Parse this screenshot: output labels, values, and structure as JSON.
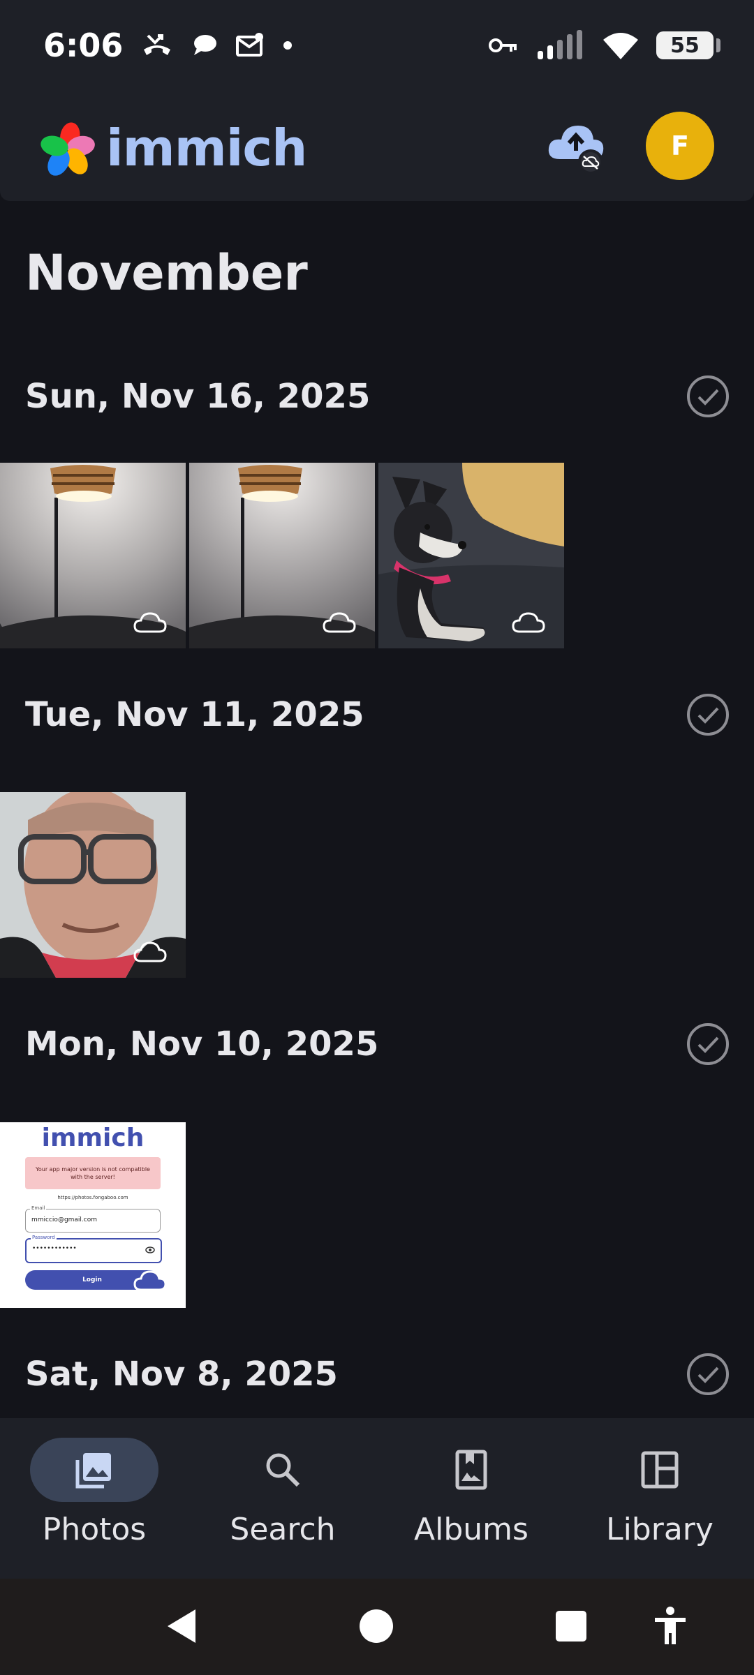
{
  "status_bar": {
    "time": "6:06",
    "battery": "55",
    "icons": [
      "missed-call-icon",
      "chat-bubble-icon",
      "mail-icon",
      "dot-icon",
      "vpn-key-icon",
      "signal-icon",
      "wifi-icon",
      "battery-icon"
    ]
  },
  "header": {
    "app_name": "immich",
    "avatar_letter": "F",
    "colors": {
      "brand_text": "#a9c3f5",
      "avatar_bg": "#e8b10c",
      "backup_icon": "#a9c3f5"
    }
  },
  "timeline": {
    "month": "November",
    "groups": [
      {
        "date": "Sun, Nov 16, 2025",
        "photos": [
          {
            "subject": "lamp",
            "icon": "cloud-icon"
          },
          {
            "subject": "lamp",
            "icon": "cloud-icon"
          },
          {
            "subject": "dog",
            "icon": "cloud-icon"
          }
        ]
      },
      {
        "date": "Tue, Nov 11, 2025",
        "photos": [
          {
            "subject": "selfie",
            "icon": "cloud-icon"
          }
        ]
      },
      {
        "date": "Mon, Nov 10, 2025",
        "photos": [
          {
            "subject": "login-screenshot",
            "icon": "cloud-icon"
          }
        ]
      },
      {
        "date": "Sat, Nov 8, 2025",
        "photos": []
      }
    ]
  },
  "screenshot_thumb": {
    "logo_text": "immich",
    "error": "Your app major version is not compatible with the server!",
    "server_url": "https://photos.fongaboo.com",
    "email_label": "Email",
    "email": "mmiccio@gmail.com",
    "password_label": "Password",
    "password_dots": "••••••••••••",
    "login_button": "Login"
  },
  "bottom_nav": {
    "items": [
      {
        "label": "Photos",
        "icon": "photos-icon",
        "active": true
      },
      {
        "label": "Search",
        "icon": "search-icon",
        "active": false
      },
      {
        "label": "Albums",
        "icon": "albums-icon",
        "active": false
      },
      {
        "label": "Library",
        "icon": "library-icon",
        "active": false
      }
    ]
  },
  "system_nav": [
    "back-icon",
    "home-icon",
    "recents-icon",
    "accessibility-icon"
  ]
}
